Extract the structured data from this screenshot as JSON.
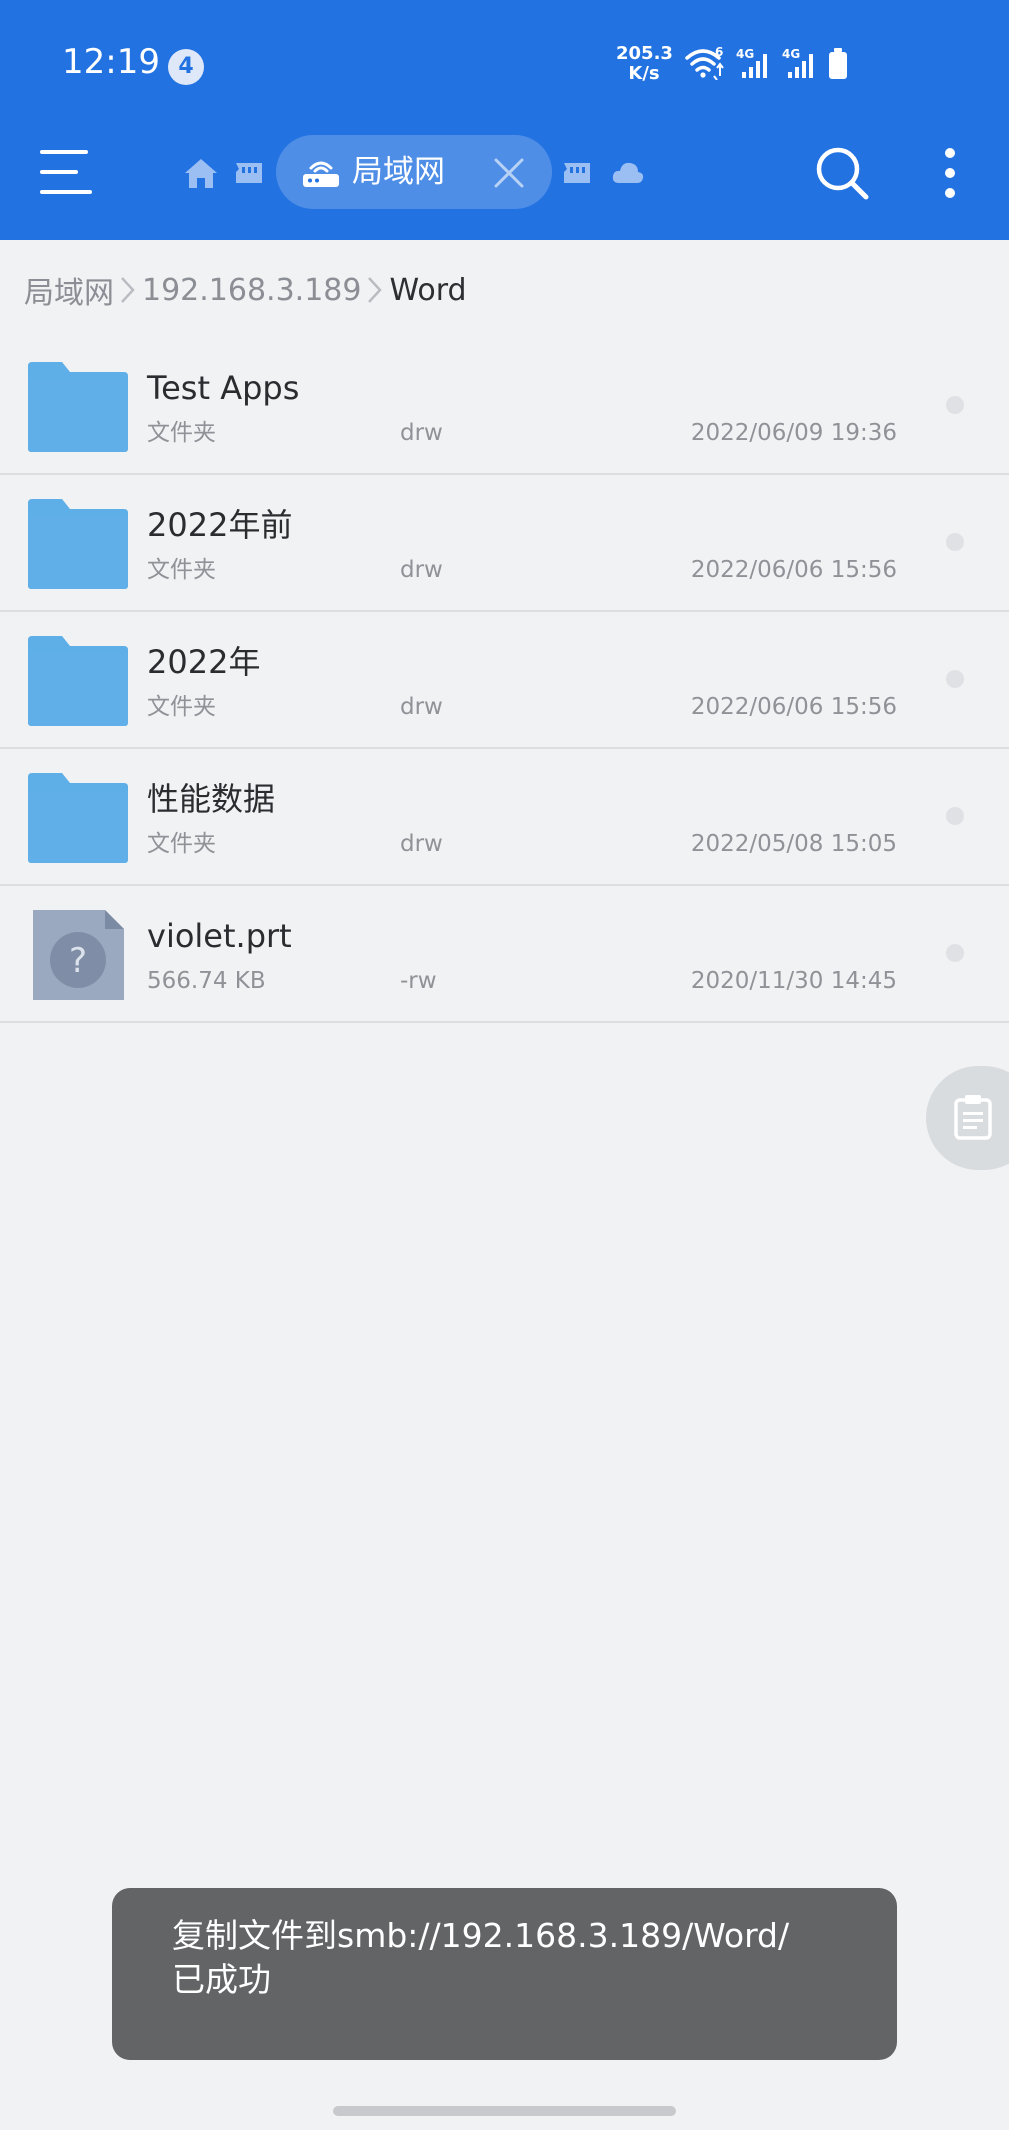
{
  "status_bar": {
    "time": "12:19",
    "notification_count": "4",
    "net_speed_value": "205.3",
    "net_speed_unit": "K/s",
    "sim1_label": "4G",
    "sim2_label": "4G",
    "wifi_label": "6",
    "icons": [
      "wifi-6-icon",
      "signal-4g-icon",
      "signal-4g-icon",
      "battery-icon"
    ]
  },
  "toolbar": {
    "menu_icon": "menu-icon",
    "search_icon": "search-icon",
    "more_icon": "more-vertical-icon",
    "active_tab": {
      "label": "局域网",
      "icon": "lan-router-icon"
    },
    "other_tabs": [
      "home-icon",
      "storage-icon",
      "storage-icon",
      "cloud-icon"
    ]
  },
  "breadcrumb": {
    "items": [
      "局域网",
      "192.168.3.189",
      "Word"
    ]
  },
  "files": [
    {
      "name": "Test Apps",
      "kind": "文件夹",
      "perm": "drw",
      "date": "2022/06/09 19:36",
      "icon": "folder-icon"
    },
    {
      "name": "2022年前",
      "kind": "文件夹",
      "perm": "drw",
      "date": "2022/06/06 15:56",
      "icon": "folder-icon"
    },
    {
      "name": "2022年",
      "kind": "文件夹",
      "perm": "drw",
      "date": "2022/06/06 15:56",
      "icon": "folder-icon"
    },
    {
      "name": "性能数据",
      "kind": "文件夹",
      "perm": "drw",
      "date": "2022/05/08 15:05",
      "icon": "folder-icon"
    },
    {
      "name": "violet.prt",
      "kind": "566.74 KB",
      "perm": "-rw",
      "date": "2020/11/30 14:45",
      "icon": "unknown-file-icon"
    }
  ],
  "fab": {
    "icon": "clipboard-icon"
  },
  "toast": {
    "line1": "复制文件到smb://192.168.3.189/Word/",
    "line2": "已成功"
  },
  "colors": {
    "appbar": "#2272e2",
    "background": "#f1f2f4",
    "folder": "#5eaee8",
    "toast": "#636466"
  }
}
